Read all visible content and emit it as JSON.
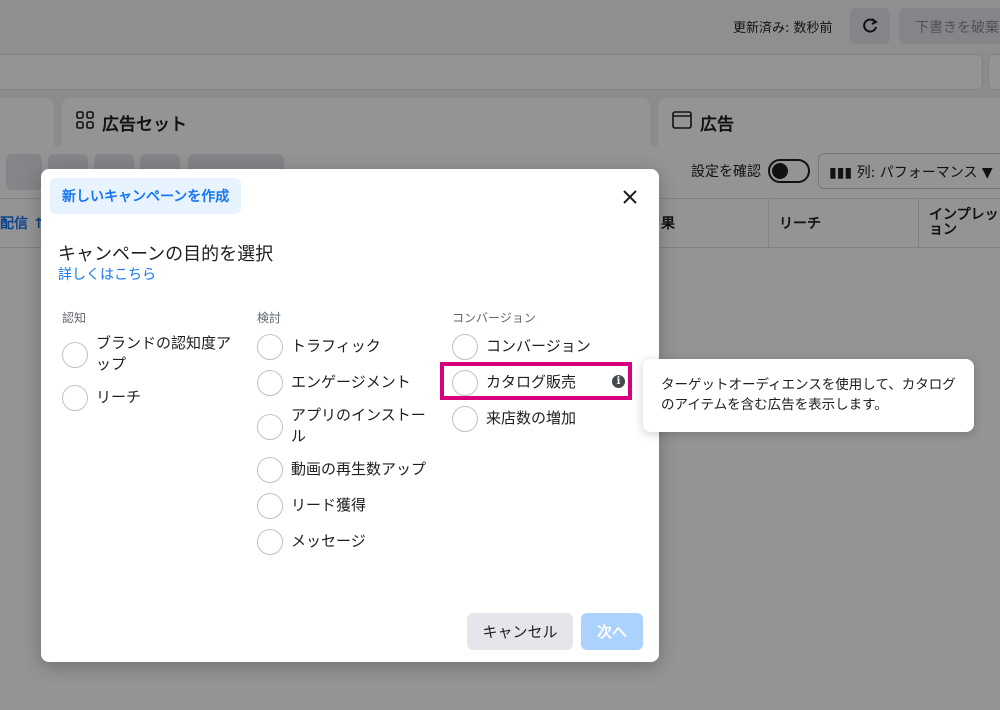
{
  "topbar": {
    "updated_text": "更新済み: 数秒前",
    "discard_label": "下書きを破棄"
  },
  "tabs": {
    "adset": "広告セット",
    "ad": "広告"
  },
  "toolbar": {
    "confirm_label": "設定を確認",
    "columns_label": "列: パフォーマンス"
  },
  "table": {
    "headers": {
      "delivery": "配信 ↑",
      "result": "果",
      "reach": "リーチ",
      "impressions": "インプレッション"
    }
  },
  "modal": {
    "tab_label": "新しいキャンペーンを作成",
    "title": "キャンペーンの目的を選択",
    "learn_more": "詳しくはこちら",
    "columns": [
      {
        "title": "認知",
        "options": [
          "ブランドの認知度アップ",
          "リーチ"
        ]
      },
      {
        "title": "検討",
        "options": [
          "トラフィック",
          "エンゲージメント",
          "アプリのインストール",
          "動画の再生数アップ",
          "リード獲得",
          "メッセージ"
        ]
      },
      {
        "title": "コンバージョン",
        "options": [
          "コンバージョン",
          "カタログ販売",
          "来店数の増加"
        ]
      }
    ],
    "cancel_label": "キャンセル",
    "next_label": "次へ"
  },
  "tooltip": {
    "text": "ターゲットオーディエンスを使用して、カタログのアイテムを含む広告を表示します。"
  },
  "colors": {
    "accent": "#1877f2",
    "highlight": "#d6007e",
    "next_disabled": "#aad2fc"
  },
  "icons": [
    "refresh-icon",
    "adset-grid-icon",
    "ad-frame-icon",
    "columns-icon",
    "close-icon",
    "info-icon"
  ]
}
